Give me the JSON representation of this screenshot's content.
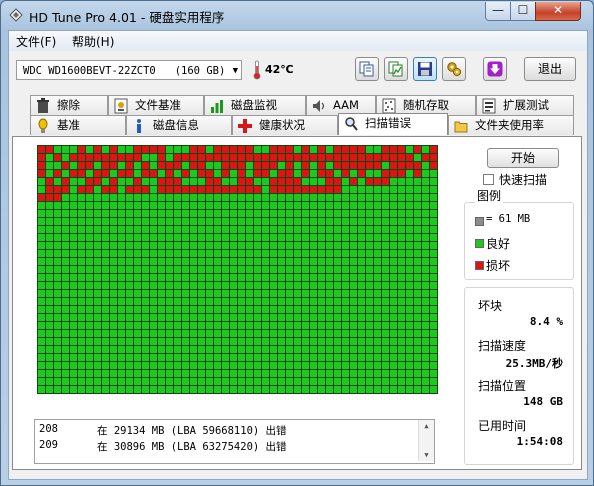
{
  "window": {
    "title": "HD Tune Pro 4.01 - 硬盘实用程序",
    "minimize_glyph": "—",
    "maximize_glyph": "☐",
    "close_glyph": "✕"
  },
  "menu": {
    "file": "文件(F)",
    "help": "帮助(H)"
  },
  "toolbar": {
    "drive": "WDC WD1600BEVT-22ZCT0   (160 GB)",
    "dropdown_glyph": "▼",
    "temperature": "42℃",
    "exit_label": "退出",
    "icons": [
      "copy-text-icon",
      "copy-screenshot-icon",
      "save-icon",
      "options-icon",
      "download-icon"
    ]
  },
  "tabs": {
    "row_top": [
      {
        "id": "erase",
        "label": "擦除",
        "icon": "trash-icon"
      },
      {
        "id": "file-benchmark",
        "label": "文件基准",
        "icon": "file-benchmark-icon"
      },
      {
        "id": "disk-monitor",
        "label": "磁盘监视",
        "icon": "monitor-chart-icon"
      },
      {
        "id": "aam",
        "label": "AAM",
        "icon": "speaker-icon"
      },
      {
        "id": "random-access",
        "label": "随机存取",
        "icon": "random-access-icon"
      },
      {
        "id": "extra-tests",
        "label": "扩展测试",
        "icon": "extra-tests-icon"
      }
    ],
    "row_bottom": [
      {
        "id": "benchmark",
        "label": "基准",
        "icon": "benchmark-icon"
      },
      {
        "id": "info",
        "label": "磁盘信息",
        "icon": "info-icon"
      },
      {
        "id": "health",
        "label": "健康状况",
        "icon": "health-cross-icon"
      },
      {
        "id": "error-scan",
        "label": "扫描错误",
        "icon": "magnifier-icon",
        "active": true
      },
      {
        "id": "folder-usage",
        "label": "文件夹使用率",
        "icon": "folder-icon"
      }
    ]
  },
  "scan": {
    "start_label": "开始",
    "quick_scan_label": "快速扫描",
    "quick_scan_checked": false,
    "legend_title": "图例",
    "legend": [
      {
        "label": "= 61 MB",
        "color": "#8c8c8c"
      },
      {
        "label": "良好",
        "color": "#1ec81e"
      },
      {
        "label": "损坏",
        "color": "#dc1414"
      }
    ],
    "stats": {
      "damaged_label": "坏块",
      "damaged_value": "8.4 %",
      "speed_label": "扫描速度",
      "speed_value": "25.3MB/秒",
      "position_label": "扫描位置",
      "position_value": "148 GB",
      "elapsed_label": "已用时间",
      "elapsed_value": "1:54:08"
    },
    "log": [
      {
        "num": "208",
        "text": "在 29134 MB (LBA 59668110) 出错"
      },
      {
        "num": "209",
        "text": "在 30896 MB (LBA 63275420) 出错"
      }
    ],
    "log_scroll_up": "▲",
    "log_scroll_down": "▼",
    "grid": {
      "columns": 50,
      "rows": 31,
      "good_color": "#1ec81e",
      "bad_color": "#dc1414",
      "bad_blocks": [
        [
          0,
          1,
          5,
          7,
          9,
          12,
          13,
          14,
          15,
          19,
          20,
          22,
          23,
          24,
          25,
          26,
          29,
          30,
          31,
          33,
          35,
          37,
          38,
          39,
          40,
          43,
          44,
          45,
          47,
          49
        ],
        [
          0,
          2,
          4,
          5,
          6,
          7,
          8,
          9,
          10,
          11,
          12,
          15,
          17,
          18,
          19,
          20,
          21,
          22,
          23,
          24,
          25,
          26,
          27,
          28,
          29,
          30,
          31,
          32,
          33,
          34,
          35,
          36,
          37,
          38,
          39,
          40,
          41,
          42,
          43,
          44,
          45,
          46,
          48,
          49
        ],
        [
          0,
          3,
          5,
          6,
          8,
          9,
          11,
          13,
          15,
          16,
          17,
          19,
          20,
          23,
          24,
          25,
          27,
          28,
          29,
          31,
          33,
          35,
          37,
          38,
          39,
          40,
          41,
          42,
          44,
          45,
          46,
          47,
          49
        ],
        [
          0,
          2,
          4,
          5,
          7,
          8,
          10,
          11,
          13,
          14,
          16,
          18,
          20,
          21,
          23,
          25,
          27,
          28,
          30,
          31,
          33,
          35,
          36,
          38,
          40,
          43,
          44,
          45,
          47
        ],
        [
          1,
          3,
          6,
          7,
          9,
          12,
          15,
          16,
          17,
          21,
          22,
          25,
          26,
          29,
          30,
          31,
          32,
          36,
          37,
          39,
          41,
          42,
          43
        ],
        [
          1,
          2,
          3,
          5,
          6,
          8,
          9,
          11,
          12,
          13,
          15,
          16,
          17,
          18,
          19,
          20,
          21,
          22,
          23,
          24,
          25,
          26,
          27,
          29,
          30,
          31,
          32,
          33,
          34,
          35,
          36,
          37
        ],
        [
          0,
          1,
          2
        ]
      ]
    }
  }
}
